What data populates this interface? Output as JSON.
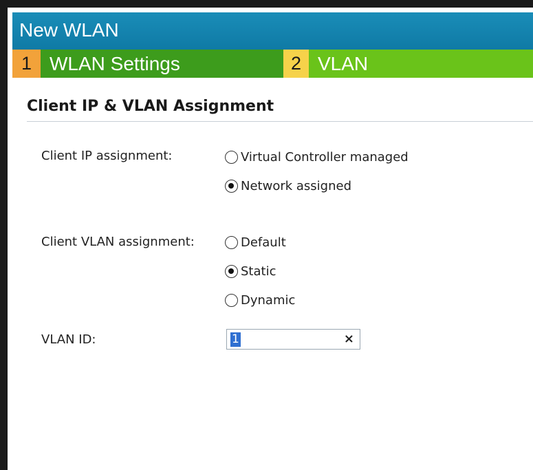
{
  "window": {
    "title": "New WLAN"
  },
  "steps": [
    {
      "number": "1",
      "label": "WLAN Settings"
    },
    {
      "number": "2",
      "label": "VLAN"
    }
  ],
  "section": {
    "title": "Client IP & VLAN Assignment"
  },
  "client_ip": {
    "label": "Client IP assignment:",
    "options": [
      {
        "label": "Virtual Controller managed",
        "selected": false
      },
      {
        "label": "Network assigned",
        "selected": true
      }
    ]
  },
  "client_vlan": {
    "label": "Client VLAN assignment:",
    "options": [
      {
        "label": "Default",
        "selected": false
      },
      {
        "label": "Static",
        "selected": true
      },
      {
        "label": "Dynamic",
        "selected": false
      }
    ]
  },
  "vlan_id": {
    "label": "VLAN ID:",
    "value": "1",
    "clear_icon": "close-icon",
    "clear_glyph": "×"
  },
  "colors": {
    "title_bar": "#0f7aa5",
    "step1_number": "#f2a23a",
    "step1_label": "#3d9c1c",
    "step2_number": "#f6d24a",
    "step2_label": "#6ac31a",
    "selection": "#2f6fd1"
  }
}
